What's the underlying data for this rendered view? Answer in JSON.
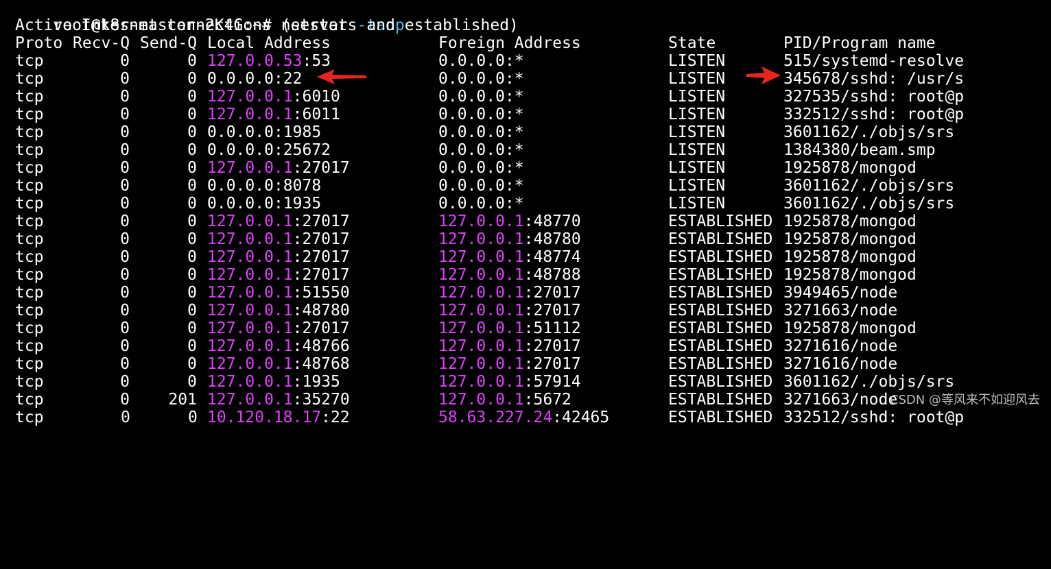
{
  "prompt": {
    "user_host": "root@k8s-master-2K4G:~#",
    "command": "netstat",
    "flag": "-tanp"
  },
  "summary": "Active Internet connections (servers and established)",
  "headers": {
    "proto": "Proto",
    "recvq": "Recv-Q",
    "sendq": "Send-Q",
    "local": "Local Address",
    "foreign": "Foreign Address",
    "state": "State",
    "program": "PID/Program name"
  },
  "rows": [
    {
      "proto": "tcp",
      "recvq": "0",
      "sendq": "0",
      "local_ip": "127.0.0.53",
      "local_port": ":53",
      "local_hl": true,
      "foreign_ip": "0.0.0.0",
      "foreign_port": ":*",
      "foreign_hl": false,
      "state": "LISTEN",
      "program": "515/systemd-resolve"
    },
    {
      "proto": "tcp",
      "recvq": "0",
      "sendq": "0",
      "local_ip": "0.0.0.0",
      "local_port": ":22",
      "local_hl": false,
      "foreign_ip": "0.0.0.0",
      "foreign_port": ":*",
      "foreign_hl": false,
      "state": "LISTEN",
      "program": "345678/sshd: /usr/s"
    },
    {
      "proto": "tcp",
      "recvq": "0",
      "sendq": "0",
      "local_ip": "127.0.0.1",
      "local_port": ":6010",
      "local_hl": true,
      "foreign_ip": "0.0.0.0",
      "foreign_port": ":*",
      "foreign_hl": false,
      "state": "LISTEN",
      "program": "327535/sshd: root@p"
    },
    {
      "proto": "tcp",
      "recvq": "0",
      "sendq": "0",
      "local_ip": "127.0.0.1",
      "local_port": ":6011",
      "local_hl": true,
      "foreign_ip": "0.0.0.0",
      "foreign_port": ":*",
      "foreign_hl": false,
      "state": "LISTEN",
      "program": "332512/sshd: root@p"
    },
    {
      "proto": "tcp",
      "recvq": "0",
      "sendq": "0",
      "local_ip": "0.0.0.0",
      "local_port": ":1985",
      "local_hl": false,
      "foreign_ip": "0.0.0.0",
      "foreign_port": ":*",
      "foreign_hl": false,
      "state": "LISTEN",
      "program": "3601162/./objs/srs"
    },
    {
      "proto": "tcp",
      "recvq": "0",
      "sendq": "0",
      "local_ip": "0.0.0.0",
      "local_port": ":25672",
      "local_hl": false,
      "foreign_ip": "0.0.0.0",
      "foreign_port": ":*",
      "foreign_hl": false,
      "state": "LISTEN",
      "program": "1384380/beam.smp"
    },
    {
      "proto": "tcp",
      "recvq": "0",
      "sendq": "0",
      "local_ip": "127.0.0.1",
      "local_port": ":27017",
      "local_hl": true,
      "foreign_ip": "0.0.0.0",
      "foreign_port": ":*",
      "foreign_hl": false,
      "state": "LISTEN",
      "program": "1925878/mongod"
    },
    {
      "proto": "tcp",
      "recvq": "0",
      "sendq": "0",
      "local_ip": "0.0.0.0",
      "local_port": ":8078",
      "local_hl": false,
      "foreign_ip": "0.0.0.0",
      "foreign_port": ":*",
      "foreign_hl": false,
      "state": "LISTEN",
      "program": "3601162/./objs/srs"
    },
    {
      "proto": "tcp",
      "recvq": "0",
      "sendq": "0",
      "local_ip": "0.0.0.0",
      "local_port": ":1935",
      "local_hl": false,
      "foreign_ip": "0.0.0.0",
      "foreign_port": ":*",
      "foreign_hl": false,
      "state": "LISTEN",
      "program": "3601162/./objs/srs"
    },
    {
      "proto": "tcp",
      "recvq": "0",
      "sendq": "0",
      "local_ip": "127.0.0.1",
      "local_port": ":27017",
      "local_hl": true,
      "foreign_ip": "127.0.0.1",
      "foreign_port": ":48770",
      "foreign_hl": true,
      "state": "ESTABLISHED",
      "program": "1925878/mongod"
    },
    {
      "proto": "tcp",
      "recvq": "0",
      "sendq": "0",
      "local_ip": "127.0.0.1",
      "local_port": ":27017",
      "local_hl": true,
      "foreign_ip": "127.0.0.1",
      "foreign_port": ":48780",
      "foreign_hl": true,
      "state": "ESTABLISHED",
      "program": "1925878/mongod"
    },
    {
      "proto": "tcp",
      "recvq": "0",
      "sendq": "0",
      "local_ip": "127.0.0.1",
      "local_port": ":27017",
      "local_hl": true,
      "foreign_ip": "127.0.0.1",
      "foreign_port": ":48774",
      "foreign_hl": true,
      "state": "ESTABLISHED",
      "program": "1925878/mongod"
    },
    {
      "proto": "tcp",
      "recvq": "0",
      "sendq": "0",
      "local_ip": "127.0.0.1",
      "local_port": ":27017",
      "local_hl": true,
      "foreign_ip": "127.0.0.1",
      "foreign_port": ":48788",
      "foreign_hl": true,
      "state": "ESTABLISHED",
      "program": "1925878/mongod"
    },
    {
      "proto": "tcp",
      "recvq": "0",
      "sendq": "0",
      "local_ip": "127.0.0.1",
      "local_port": ":51550",
      "local_hl": true,
      "foreign_ip": "127.0.0.1",
      "foreign_port": ":27017",
      "foreign_hl": true,
      "state": "ESTABLISHED",
      "program": "3949465/node"
    },
    {
      "proto": "tcp",
      "recvq": "0",
      "sendq": "0",
      "local_ip": "127.0.0.1",
      "local_port": ":48780",
      "local_hl": true,
      "foreign_ip": "127.0.0.1",
      "foreign_port": ":27017",
      "foreign_hl": true,
      "state": "ESTABLISHED",
      "program": "3271663/node"
    },
    {
      "proto": "tcp",
      "recvq": "0",
      "sendq": "0",
      "local_ip": "127.0.0.1",
      "local_port": ":27017",
      "local_hl": true,
      "foreign_ip": "127.0.0.1",
      "foreign_port": ":51112",
      "foreign_hl": true,
      "state": "ESTABLISHED",
      "program": "1925878/mongod"
    },
    {
      "proto": "tcp",
      "recvq": "0",
      "sendq": "0",
      "local_ip": "127.0.0.1",
      "local_port": ":48766",
      "local_hl": true,
      "foreign_ip": "127.0.0.1",
      "foreign_port": ":27017",
      "foreign_hl": true,
      "state": "ESTABLISHED",
      "program": "3271616/node"
    },
    {
      "proto": "tcp",
      "recvq": "0",
      "sendq": "0",
      "local_ip": "127.0.0.1",
      "local_port": ":48768",
      "local_hl": true,
      "foreign_ip": "127.0.0.1",
      "foreign_port": ":27017",
      "foreign_hl": true,
      "state": "ESTABLISHED",
      "program": "3271616/node"
    },
    {
      "proto": "tcp",
      "recvq": "0",
      "sendq": "0",
      "local_ip": "127.0.0.1",
      "local_port": ":1935",
      "local_hl": true,
      "foreign_ip": "127.0.0.1",
      "foreign_port": ":57914",
      "foreign_hl": true,
      "state": "ESTABLISHED",
      "program": "3601162/./objs/srs"
    },
    {
      "proto": "tcp",
      "recvq": "0",
      "sendq": "201",
      "local_ip": "127.0.0.1",
      "local_port": ":35270",
      "local_hl": true,
      "foreign_ip": "127.0.0.1",
      "foreign_port": ":5672",
      "foreign_hl": true,
      "state": "ESTABLISHED",
      "program": "3271663/node"
    }
  ],
  "partial_row": {
    "proto": "tcp",
    "recvq": "0",
    "sendq": "0",
    "local_ip": "10.120.18.17",
    "local_port": ":22",
    "foreign_ip": "58.63.227.24",
    "foreign_port": ":42465",
    "state": "ESTABLISHED",
    "program": "332512/sshd: root@p"
  },
  "watermark": "CSDN @等风来不如迎风去",
  "colors": {
    "background": "#000000",
    "text": "#ffffff",
    "highlight_ip": "#e040fb",
    "flag": "#4fb8e6",
    "arrow": "#e8261f"
  }
}
